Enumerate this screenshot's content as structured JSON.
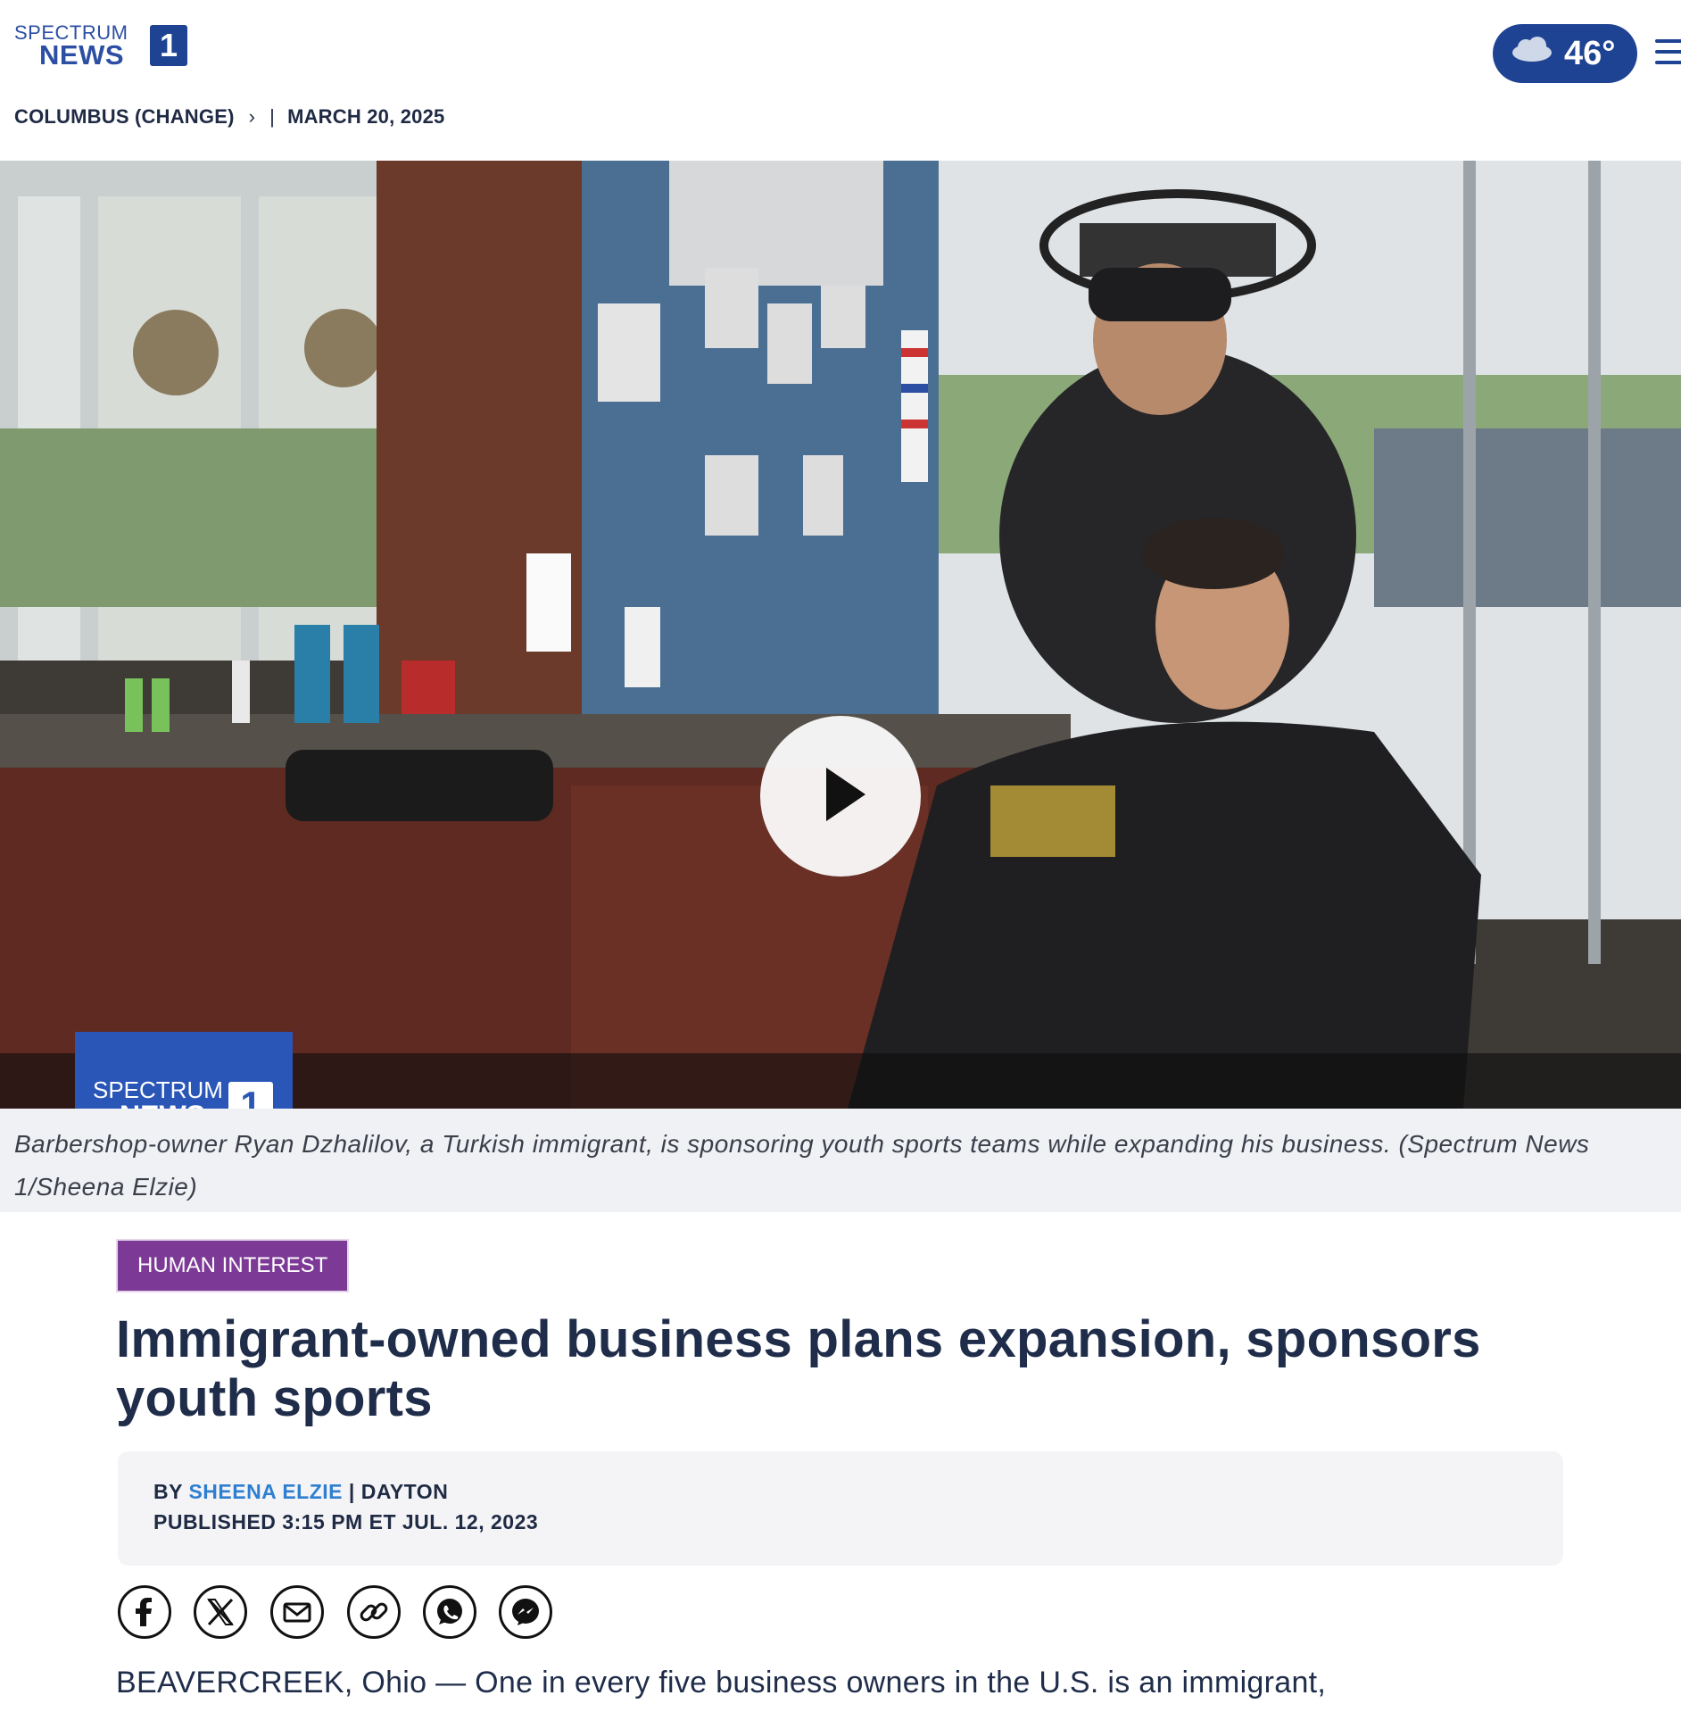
{
  "header": {
    "logo": {
      "line1": "SPECTRUM",
      "line2": "NEWS",
      "number": "1"
    },
    "weather": {
      "temperature": "46°",
      "icon": "cloud-icon"
    },
    "menu_icon": "hamburger-menu-icon"
  },
  "breadcrumb": {
    "location": "COLUMBUS (CHANGE)",
    "date": "MARCH 20, 2025"
  },
  "hero": {
    "video_play_icon": "play-icon",
    "watermark": {
      "line1": "SPECTRUM",
      "line2": "NEWS",
      "number": "1"
    },
    "caption": "Barbershop-owner Ryan Dzhalilov, a Turkish immigrant, is sponsoring youth sports teams while expanding his business. (Spectrum News 1/Sheena Elzie)"
  },
  "article": {
    "tag": "HUMAN INTEREST",
    "title": "Immigrant-owned business plans expansion, sponsors youth sports",
    "byline_prefix": "BY ",
    "author": "SHEENA ELZIE",
    "location": " | DAYTON",
    "published": "PUBLISHED 3:15 PM ET JUL. 12, 2023",
    "share": [
      {
        "icon": "facebook-icon"
      },
      {
        "icon": "x-twitter-icon"
      },
      {
        "icon": "email-icon"
      },
      {
        "icon": "link-icon"
      },
      {
        "icon": "whatsapp-icon"
      },
      {
        "icon": "messenger-icon"
      }
    ],
    "body_first_line": "BEAVERCREEK, Ohio — One in every five business owners in the U.S. is an immigrant,"
  },
  "colors": {
    "brand_blue": "#1f4393",
    "tag_purple": "#7c3a96",
    "author_link": "#2f7fd1"
  }
}
